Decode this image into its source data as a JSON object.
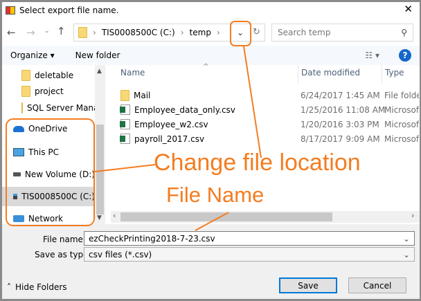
{
  "window": {
    "title": "Select export file name.",
    "close": "✕"
  },
  "address": {
    "path": [
      "TIS0008500C (C:)",
      "temp"
    ],
    "search_placeholder": "Search temp"
  },
  "toolbar": {
    "organize": "Organize ▾",
    "new_folder": "New folder",
    "view": "☷ ▾",
    "help": "?"
  },
  "nav": {
    "items": [
      {
        "label": "deletable",
        "icon": "folder-icon"
      },
      {
        "label": "project",
        "icon": "folder-icon"
      },
      {
        "label": "SQL Server Mana",
        "icon": "folder-icon"
      },
      {
        "label": "OneDrive",
        "icon": "cloud-icon"
      },
      {
        "label": "This PC",
        "icon": "computer-icon"
      },
      {
        "label": "New Volume (D:)",
        "icon": "drive-icon"
      },
      {
        "label": "TIS0008500C (C:)",
        "icon": "windows-drive-icon",
        "selected": true
      },
      {
        "label": "Network",
        "icon": "network-icon"
      }
    ]
  },
  "columns": {
    "name": "Name",
    "date": "Date modified",
    "type": "Type"
  },
  "files": [
    {
      "name": "Mail",
      "date": "6/24/2017 1:45 AM",
      "type": "File folder",
      "icon": "folder-icon"
    },
    {
      "name": "Employee_data_only.csv",
      "date": "1/25/2016 11:08 AM",
      "type": "Microsoft",
      "icon": "excel-csv-icon"
    },
    {
      "name": "Employee_w2.csv",
      "date": "1/20/2016 3:03 PM",
      "type": "Microsoft",
      "icon": "excel-csv-icon"
    },
    {
      "name": "payroll_2017.csv",
      "date": "8/17/2017 9:09 AM",
      "type": "Microsoft",
      "icon": "excel-csv-icon"
    }
  ],
  "form": {
    "file_name_label": "File name:",
    "file_name_value": "ezCheckPrinting2018-7-23.csv",
    "save_type_label": "Save as type:",
    "save_type_value": "csv files (*.csv)"
  },
  "footer": {
    "hide_folders": "Hide Folders",
    "save": "Save",
    "cancel": "Cancel"
  },
  "annotations": {
    "change_location": "Change file location",
    "file_name": "File Name",
    "color": "#f47c20"
  }
}
